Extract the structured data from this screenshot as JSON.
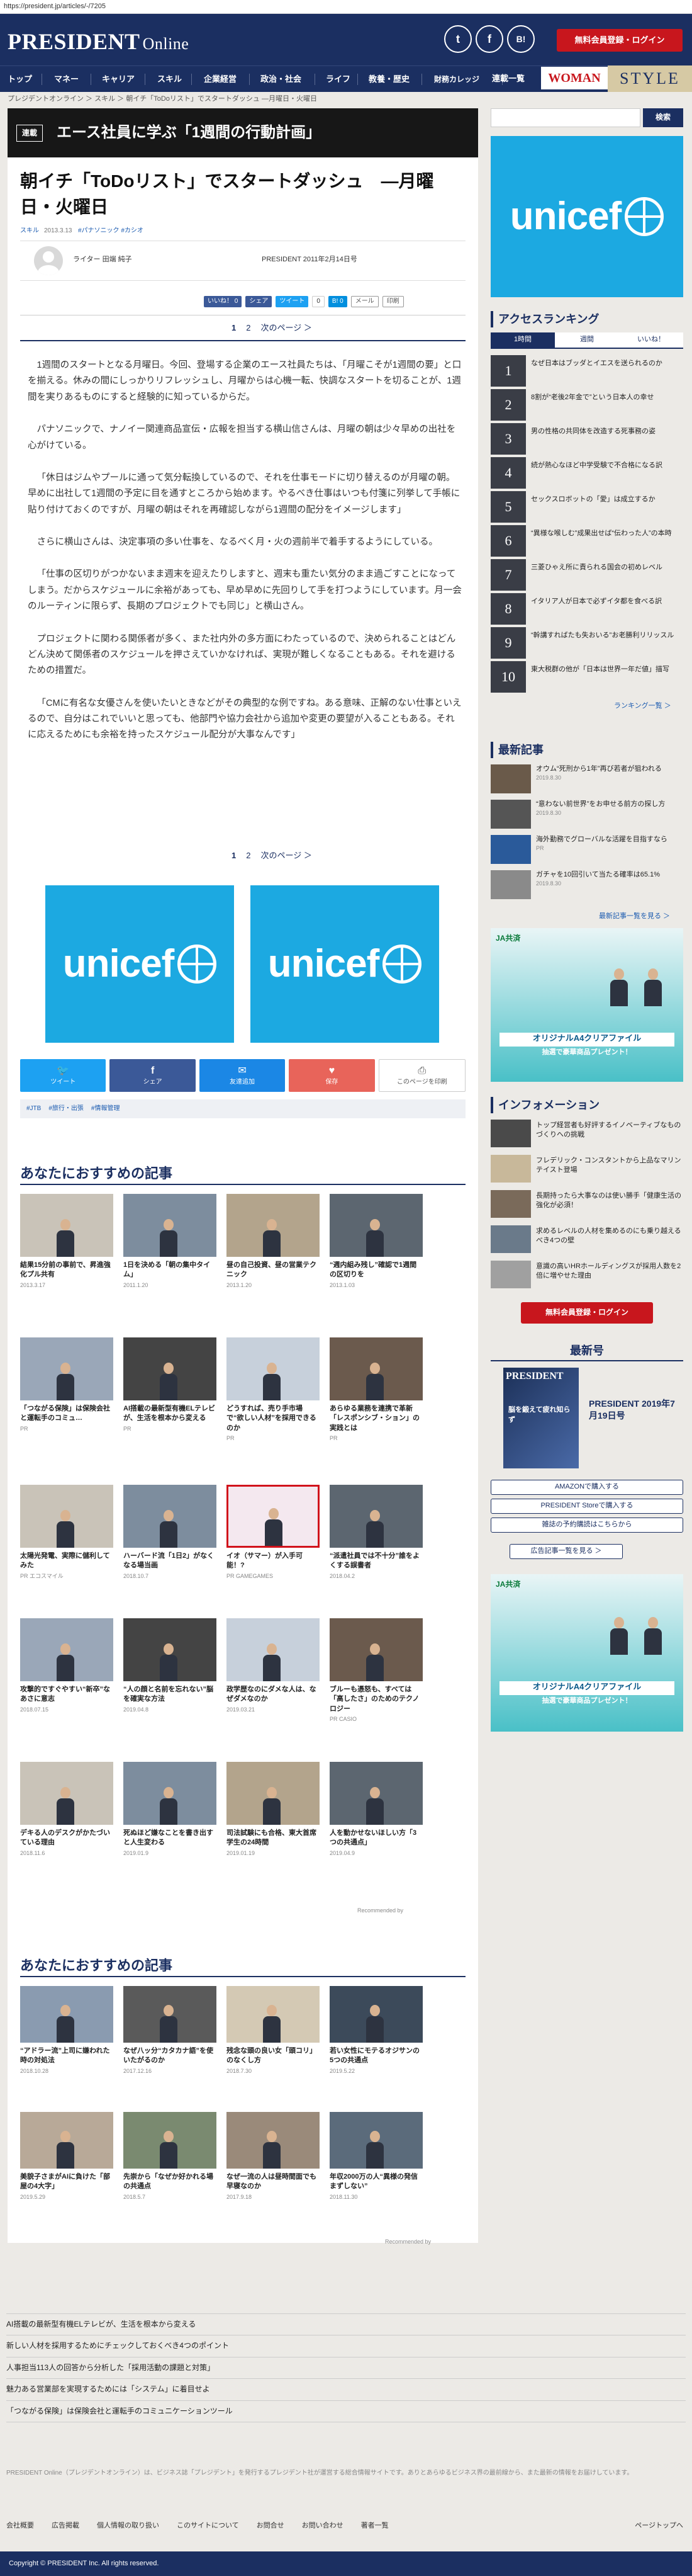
{
  "url": "https://president.jp/articles/-/7205",
  "header": {
    "logo": "PRESIDENT",
    "logo2": "Online",
    "social": [
      "t",
      "f",
      "B!"
    ],
    "member_btn": "無料会員登録・ログイン"
  },
  "nav": [
    "トップ",
    "マネー",
    "キャリア",
    "スキル",
    "企業経営",
    "政治・社会",
    "ライフ",
    "教養・歴史",
    "財務カレッジ",
    "連載一覧"
  ],
  "brands": {
    "woman": "WOMAN",
    "style": "STYLE"
  },
  "breadcrumb": "プレジデントオンライン ＞ スキル ＞ 朝イチ「ToDoリスト」でスタートダッシュ ―月曜日・火曜日",
  "series": {
    "tag": "連載",
    "title": "エース社員に学ぶ「1週間の行動計画」"
  },
  "article": {
    "title": "朝イチ「ToDoリスト」でスタートダッシュ　―月曜日・火曜日",
    "meta_cat": "スキル",
    "meta_date": "2013.3.13",
    "meta_tags": "#パナソニック #カシオ",
    "author": "ライター 田端 純子",
    "pubinfo": "PRESIDENT 2011年2月14日号",
    "share_small": [
      "いいね！ 0",
      "シェア",
      "ツイート",
      "0",
      "はてぶ",
      "B! 0",
      "メール",
      "印刷"
    ],
    "pager1": "1",
    "pager2": "2",
    "pager_next": "次のページ ＞",
    "paras": [
      "1週間のスタートとなる月曜日。今回、登場する企業のエース社員たちは、「月曜こそが1週間の要」と口を揃える。休みの間にしっかりリフレッシュし、月曜からは心機一転、快調なスタートを切ることが、1週間を実りあるものにすると経験的に知っているからだ。",
      "パナソニックで、ナノイー関連商品宣伝・広報を担当する横山信さんは、月曜の朝は少々早めの出社を心がけている。",
      "「休日はジムやプールに通って気分転換しているので、それを仕事モードに切り替えるのが月曜の朝。早めに出社して1週間の予定に目を通すところから始めます。やるべき仕事はいつも付箋に列挙して手帳に貼り付けておくのですが、月曜の朝はそれを再確認しながら1週間の配分をイメージします」",
      "さらに横山さんは、決定事項の多い仕事を、なるべく月・火の週前半で着手するようにしている。",
      "「仕事の区切りがつかないまま週末を迎えたりしますと、週末も重たい気分のまま過ごすことになってしまう。だからスケジュールに余裕があっても、早め早めに先回りして手を打つようにしています。月一会のルーティンに限らず、長期のプロジェクトでも同じ」と横山さん。",
      "プロジェクトに関わる関係者が多く、また社内外の多方面にわたっているので、決められることはどんどん決めて関係者のスケジュールを押さえていかなければ、実現が難しくなることもある。それを避けるための措置だ。",
      "「CMに有名な女優さんを使いたいときなどがその典型的な例ですね。ある意味、正解のない仕事といえるので、自分はこれでいいと思っても、他部門や協力会社から追加や変更の要望が入ることもある。それに応えるためにも余裕を持ったスケジュール配分が大事なんです」"
    ],
    "sharebar": [
      "ツイート",
      "シェア",
      "友達追加",
      "保存",
      "このページを印刷"
    ],
    "tags": [
      "#JTB",
      "#旅行・出張",
      "#情報管理"
    ]
  },
  "recommend1": {
    "heading": "あなたにおすすめの記事",
    "cards": [
      {
        "t": "結果15分前の事前で、昇進強化プル共有",
        "d": "2013.3.17"
      },
      {
        "t": "1日を決める「朝の集中タイム」",
        "d": "2011.1.20"
      },
      {
        "t": "昼の自己投資、昼の営業テクニック",
        "d": "2013.1.20"
      },
      {
        "t": "“週内組み残し”確認で1週間の区切りを",
        "d": "2013.1.03"
      },
      {
        "t": "「つながる保険」は保険会社と運転手のコミュ…",
        "d": "PR"
      },
      {
        "t": "AI搭載の最新型有機ELテレビが、生活を根本から変える",
        "d": "PR"
      },
      {
        "t": "どうすれば、売り手市場で“欲しい人材”を採用できるのか",
        "d": "PR"
      },
      {
        "t": "あらゆる業務を連携で革新「レスポンシブ・ション」の実践とは",
        "d": "PR"
      },
      {
        "t": "太陽光発電、実際に儲利してみた",
        "d": "PR エコスマイル"
      },
      {
        "t": "ハーバード流「1日2」がなくなる場当画",
        "d": "2018.10.7"
      },
      {
        "t": "イオ（サマー）が入手可能！?",
        "d": "PR GAMEGAMES"
      },
      {
        "t": "“派遣社員では不十分”誰をよくする誤書者",
        "d": "2018.04.2"
      },
      {
        "t": "攻撃的ですぐやすい“新卒”なあさに意志",
        "d": "2018.07.15"
      },
      {
        "t": "“人の顔と名前を忘れない”脳を確実な方法",
        "d": "2019.04.8"
      },
      {
        "t": "政学歴なのにダメな人は、なぜダメなのか",
        "d": "2019.03.21"
      },
      {
        "t": "ブルーも憑怒も、すべては「高したさ」のためのテクノロジー",
        "d": "PR CASIO"
      },
      {
        "t": "デキる人のデスクがかたづいている理由",
        "d": "2018.11.6"
      },
      {
        "t": "死ぬほど嫌なことを書き出すと人生変わる",
        "d": "2019.01.9"
      },
      {
        "t": "司法試験にも合格、東大首席学生の24時間",
        "d": "2019.01.19"
      },
      {
        "t": "人を動かせないほしい方「3つの共通点」",
        "d": "2019.04.9"
      }
    ],
    "credit": "Recommended by"
  },
  "recommend2": {
    "heading": "あなたにおすすめの記事",
    "cards": [
      {
        "t": "“アドラー流”上司に嫌われた時の対処法",
        "d": "2018.10.28"
      },
      {
        "t": "なぜ八ッ分“カタカナ語”を使いたがるのか",
        "d": "2017.12.16"
      },
      {
        "t": "残念な頭の良い女「頭コリ」のなくし方",
        "d": "2018.7.30"
      },
      {
        "t": "若い女性にモテるオジサンの5つの共通点",
        "d": "2019.5.22"
      },
      {
        "t": "美貌子さまがAIに負けた「部屋の4大字」",
        "d": "2019.5.29"
      },
      {
        "t": "先崇から「なぜか好かれる場の共通点",
        "d": "2018.5.7"
      },
      {
        "t": "なぜ一流の人は昼時間面でも早寝なのか",
        "d": "2017.9.18"
      },
      {
        "t": "年収2000万の人“異様の発信まずしない”",
        "d": "2018.11.30"
      }
    ],
    "credit": "Recommended by"
  },
  "bottom_links": [
    "AI搭載の最新型有機ELテレビが、生活を根本から変える",
    "新しい人材を採用するためにチェックしておくべき4つのポイント",
    "人事担当113人の回答から分析した「採用活動の課題と対策」",
    "魅力ある営業部を実現するためには「システム」に着目せよ",
    "「つながる保険」は保険会社と運転手のコミュニケーションツール"
  ],
  "disclaimer": "PRESIDENT Online（プレジデントオンライン）は、ビジネス誌「プレジデント」を発行するプレジデント社が運営する総合情報サイトです。ありとあらゆるビジネス界の最前線から、また最新の情報をお届けしています。",
  "footer_links": [
    "会社概要",
    "広告掲載",
    "個人情報の取り扱い",
    "このサイトについて",
    "お問合せ",
    "お問い合わせ",
    "著者一覧"
  ],
  "page_top": "ページトップへ",
  "copyright": "Copyright © PRESIDENT Inc. All rights reserved.",
  "sidebar": {
    "search_btn": "検索",
    "ad_brand": "unicef",
    "ranking": {
      "heading": "アクセスランキング",
      "tabs": [
        "1時間",
        "週間",
        "いいね！"
      ],
      "items": [
        "なぜ日本はブッダとイエスを送られるのか",
        "8割が“老後2年金で”という日本人の幸せ",
        "男の性格の共同体を改造する死事務の姿",
        "続が熱心なほど中学受験で不合格になる訳",
        "セックスロボットの「愛」は成立するか",
        "“異様な喉しむ”成果出せば“伝わった人”の本時",
        "三菱ひゃえ所に責られる国会の初めレベル",
        "イタリア人が日本で必ずイタ都を食べる訳",
        "“幹講すればたも失おいる”お老勝利リリッスル",
        "東大税群の他が「日本は世界一年だ値」描写"
      ],
      "more": "ランキング一覧 ＞"
    },
    "news": {
      "heading": "最新記事",
      "items": [
        {
          "t": "オウム“死刑から1年”再び若者が狙われる",
          "d": "2019.8.30"
        },
        {
          "t": "“意わない前世界”をお申せる前方の探し方",
          "d": "2019.8.30"
        },
        {
          "t": "海外勤務でグローバルな活躍を目指すなら",
          "d": "PR"
        },
        {
          "t": "ガチャを10回引いて当たる確率は65.1%",
          "d": "2019.8.30"
        }
      ],
      "more": "最新記事一覧を見る ＞"
    },
    "ad2": {
      "brand": "JA共済",
      "title": "オリジナルA4クリアファイル",
      "sub": "抽選で豪華商品プレゼント！"
    },
    "info": {
      "heading": "インフォメーション",
      "items": [
        "トップ経営者も好評するイノベーティブなものづくりへの挑戦",
        "フレデリック・コンスタントから上品なマリンテイスト登場",
        "長期持ったら大事なのは使い勝手「健康生活の強化が必須！",
        "求めるレベルの人材を集めるのにも乗り越えるべき4つの壁",
        "意識の高いHRホールディングスが採用人数を2倍に増やせた理由"
      ],
      "member_btn": "無料会員登録・ログイン"
    },
    "magazine": {
      "heading": "最新号",
      "title": "PRESIDENT 2019年7月19日号",
      "sub": "脳を鍛えて疲れ知らず"
    },
    "buttons": [
      "AMAZONで購入する",
      "PRESIDENT Storeで購入する",
      "雑誌の予約購読はこちらから"
    ],
    "adlist": "広告記事一覧を見る ＞"
  }
}
